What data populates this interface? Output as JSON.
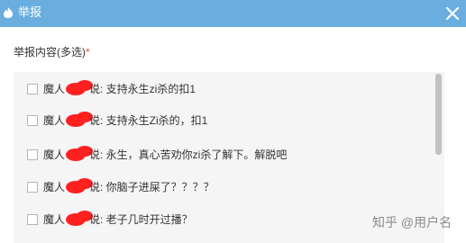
{
  "dialog": {
    "title": "举报",
    "title_icon": "fire-icon",
    "close_icon": "close-icon",
    "colors": {
      "titlebar": "#6aaee0",
      "options_background": "#f5f5f5",
      "required_star": "#e64340",
      "redaction": "#ff2020"
    }
  },
  "form": {
    "label": "举报内容(多选)",
    "required_mark": "*"
  },
  "options": [
    {
      "user": "魔人",
      "text": "说: 支持永生zi杀的扣1",
      "checked": false
    },
    {
      "user": "魔人",
      "text": "说: 支持永生Zi杀的，扣1",
      "checked": false
    },
    {
      "user": "魔人",
      "text": "说: 永生，真心苦劝你zi杀了解下。解脱吧",
      "checked": false
    },
    {
      "user": "魔人",
      "text": "说: 你脑子进屎了？？？？",
      "checked": false
    },
    {
      "user": "魔人",
      "text": "说: 老子几时开过播？",
      "checked": false
    }
  ],
  "watermark": {
    "text": "知乎 @用户名"
  }
}
